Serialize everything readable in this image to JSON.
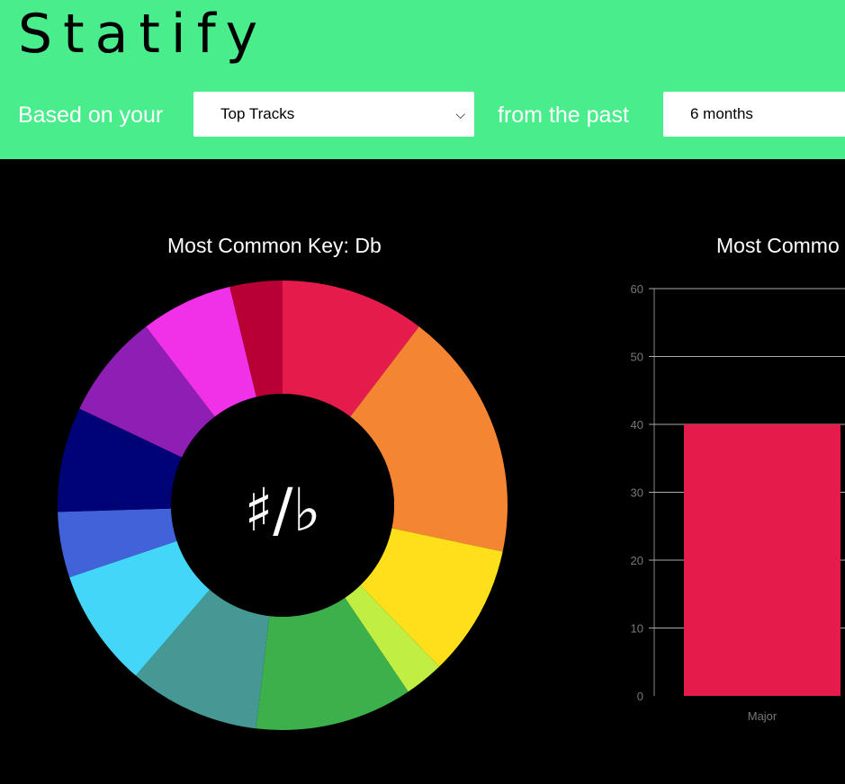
{
  "header": {
    "app_title": "Statify",
    "based_label": "Based on your",
    "type_select": {
      "selected": "Top Tracks"
    },
    "past_label": "from the past",
    "range_select": {
      "selected": "6 months"
    },
    "background_color": "#4aed8b"
  },
  "key_chart": {
    "title": "Most Common Key: Db",
    "center_label": "♯/♭"
  },
  "mode_chart": {
    "title_visible": "Most Commo"
  },
  "chart_data": [
    {
      "type": "pie",
      "title": "Most Common Key: Db",
      "colors": [
        "#e51c4b",
        "#f38533",
        "#fde019",
        "#c1ee42",
        "#3cb04b",
        "#469894",
        "#44d6f8",
        "#4162d8",
        "#000375",
        "#8f1eb4",
        "#f031e8",
        "#b80035"
      ],
      "values": [
        11,
        19,
        10,
        3,
        12,
        10,
        9,
        5,
        8,
        8,
        7,
        4
      ]
    },
    {
      "type": "bar",
      "title": "Most Commo",
      "categories": [
        "Major"
      ],
      "values": [
        40
      ],
      "ylim": [
        0,
        60
      ],
      "yticks": [
        0,
        10,
        20,
        30,
        40,
        50,
        60
      ],
      "colors": [
        "#e51c4b"
      ],
      "grid": true
    }
  ]
}
